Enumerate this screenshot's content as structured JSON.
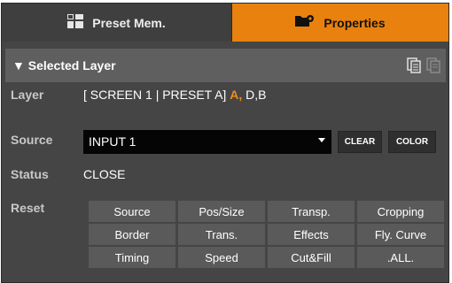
{
  "tabs": {
    "preset_label": "Preset Mem.",
    "properties_label": "Properties"
  },
  "section": {
    "title": "▼ Selected Layer"
  },
  "layer": {
    "label": "Layer",
    "value_prefix": "[ SCREEN 1 | PRESET A]",
    "active_layer": "A,",
    "other_layers": "D,B"
  },
  "source": {
    "label": "Source",
    "selected": "INPUT 1",
    "clear_label": "CLEAR",
    "color_label": "COLOR"
  },
  "status": {
    "label": "Status",
    "value": "CLOSE"
  },
  "reset": {
    "label": "Reset",
    "buttons": [
      "Source",
      "Pos/Size",
      "Transp.",
      "Cropping",
      "Border",
      "Trans.",
      "Effects",
      "Fly. Curve",
      "Timing",
      "Speed",
      "Cut&Fill",
      ".ALL."
    ]
  },
  "icons": {
    "preset_tab": "grid-icon",
    "properties_tab": "folder-settings-icon",
    "copy": "copy-icon",
    "paste": "paste-icon"
  },
  "colors": {
    "accent": "#e8810e",
    "highlight": "#f08c18",
    "panel": "#454545"
  }
}
